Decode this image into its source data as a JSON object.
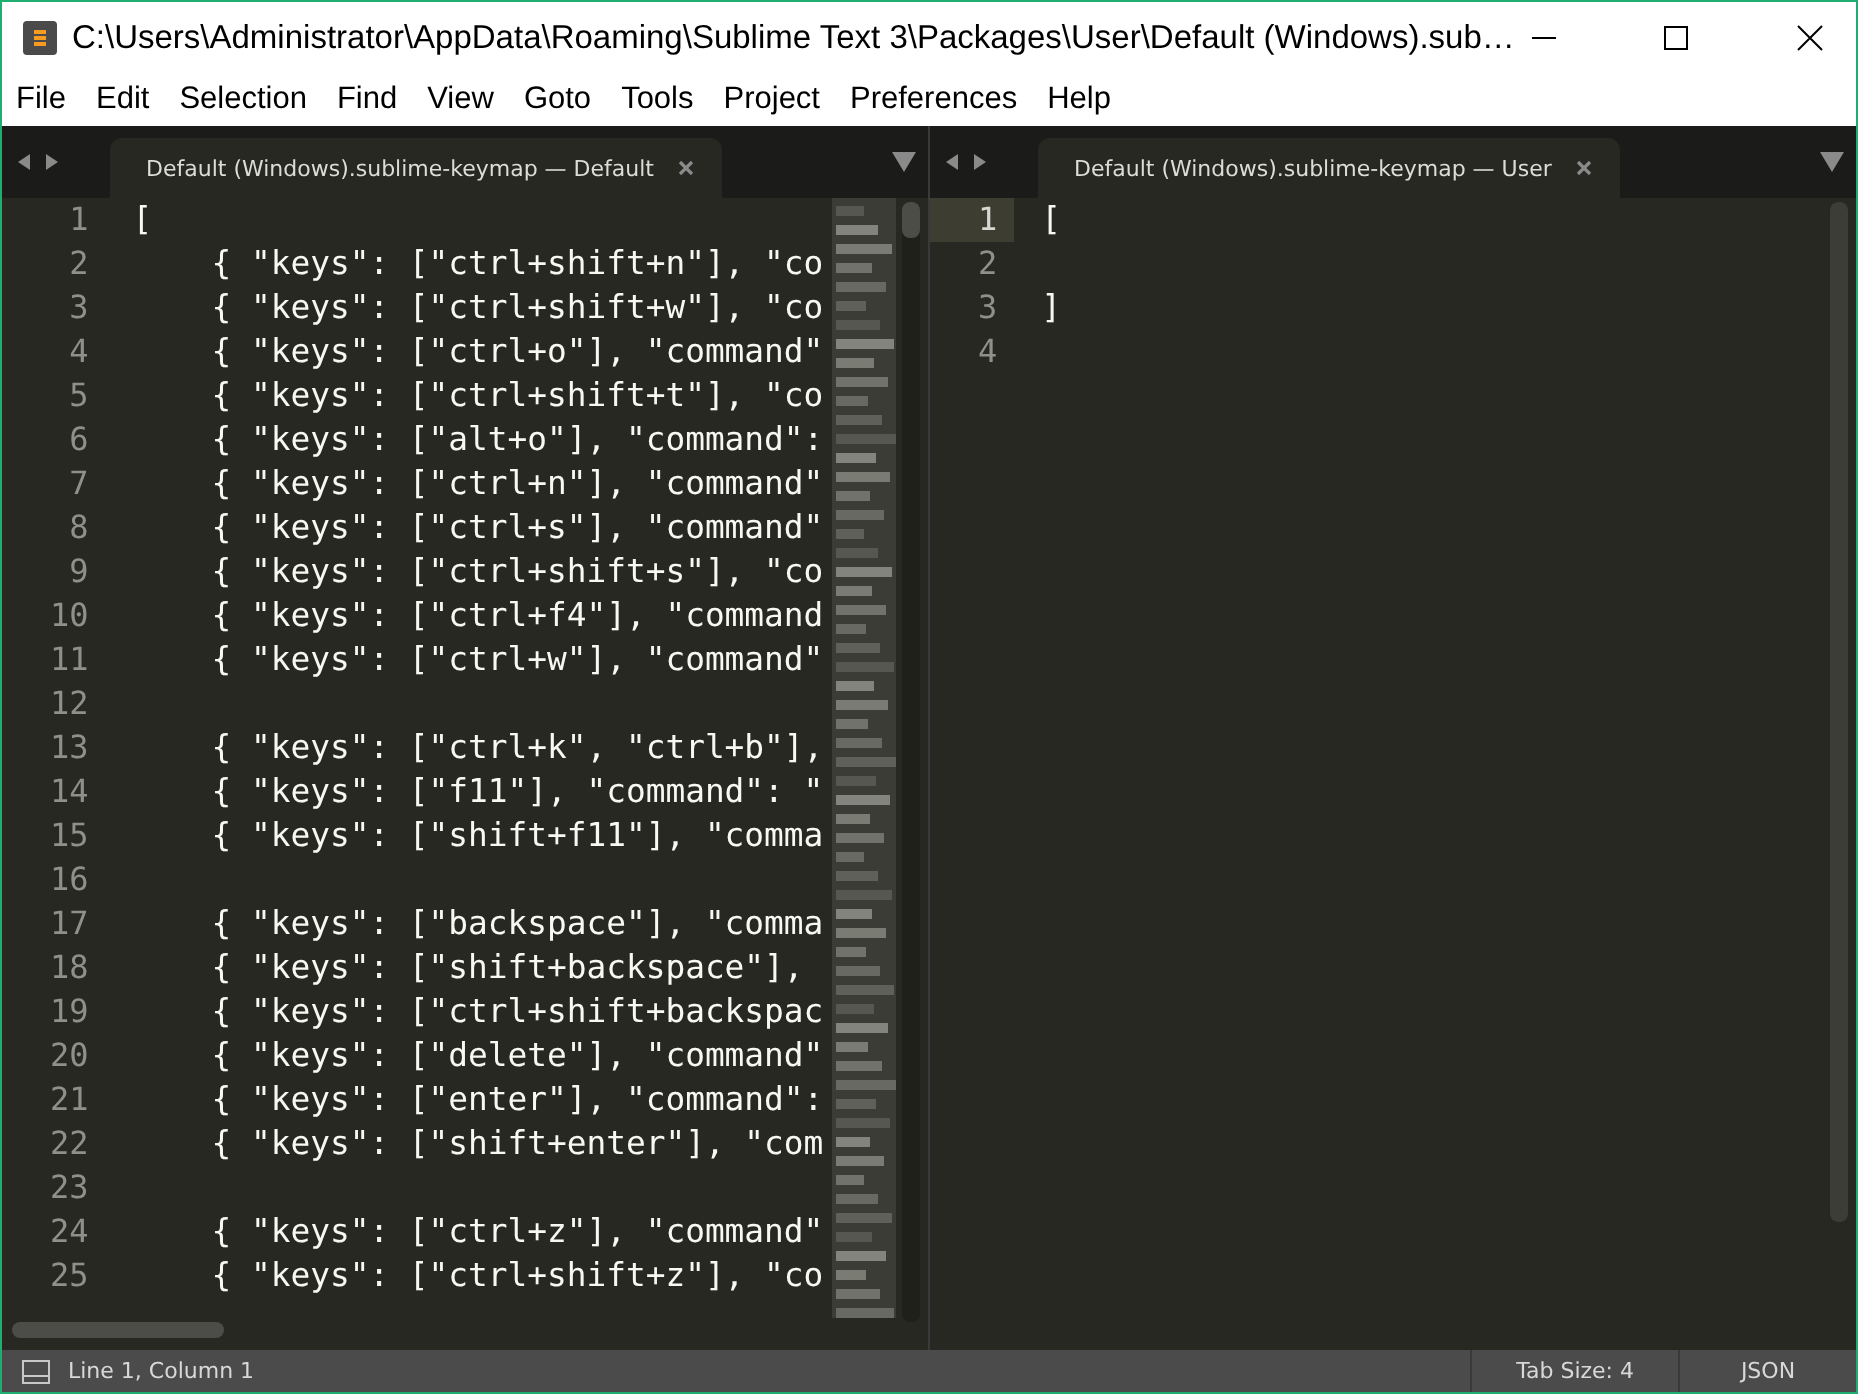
{
  "window": {
    "title": "C:\\Users\\Administrator\\AppData\\Roaming\\Sublime Text 3\\Packages\\User\\Default (Windows).sub…"
  },
  "menu": [
    "File",
    "Edit",
    "Selection",
    "Find",
    "View",
    "Goto",
    "Tools",
    "Project",
    "Preferences",
    "Help"
  ],
  "panes": [
    {
      "tab": {
        "label": "Default (Windows).sublime-keymap — Default",
        "selected": true
      },
      "minimap": true,
      "lines": [
        {
          "number": "1",
          "text": "[",
          "current": false
        },
        {
          "number": "2",
          "text": "    { \"keys\": [\"ctrl+shift+n\"], \"co",
          "current": false
        },
        {
          "number": "3",
          "text": "    { \"keys\": [\"ctrl+shift+w\"], \"co",
          "current": false
        },
        {
          "number": "4",
          "text": "    { \"keys\": [\"ctrl+o\"], \"command\"",
          "current": false
        },
        {
          "number": "5",
          "text": "    { \"keys\": [\"ctrl+shift+t\"], \"co",
          "current": false
        },
        {
          "number": "6",
          "text": "    { \"keys\": [\"alt+o\"], \"command\":",
          "current": false
        },
        {
          "number": "7",
          "text": "    { \"keys\": [\"ctrl+n\"], \"command\"",
          "current": false
        },
        {
          "number": "8",
          "text": "    { \"keys\": [\"ctrl+s\"], \"command\"",
          "current": false
        },
        {
          "number": "9",
          "text": "    { \"keys\": [\"ctrl+shift+s\"], \"co",
          "current": false
        },
        {
          "number": "10",
          "text": "    { \"keys\": [\"ctrl+f4\"], \"command",
          "current": false
        },
        {
          "number": "11",
          "text": "    { \"keys\": [\"ctrl+w\"], \"command\"",
          "current": false
        },
        {
          "number": "12",
          "current": false
        },
        {
          "number": "13",
          "text": "    { \"keys\": [\"ctrl+k\", \"ctrl+b\"],",
          "current": false
        },
        {
          "number": "14",
          "text": "    { \"keys\": [\"f11\"], \"command\": \"",
          "current": false
        },
        {
          "number": "15",
          "text": "    { \"keys\": [\"shift+f11\"], \"comma",
          "current": false
        },
        {
          "number": "16",
          "current": false
        },
        {
          "number": "17",
          "text": "    { \"keys\": [\"backspace\"], \"comma",
          "current": false
        },
        {
          "number": "18",
          "text": "    { \"keys\": [\"shift+backspace\"],",
          "current": false
        },
        {
          "number": "19",
          "text": "    { \"keys\": [\"ctrl+shift+backspac",
          "current": false
        },
        {
          "number": "20",
          "text": "    { \"keys\": [\"delete\"], \"command\"",
          "current": false
        },
        {
          "number": "21",
          "text": "    { \"keys\": [\"enter\"], \"command\":",
          "current": false
        },
        {
          "number": "22",
          "text": "    { \"keys\": [\"shift+enter\"], \"com",
          "current": false
        },
        {
          "number": "23",
          "current": false
        },
        {
          "number": "24",
          "text": "    { \"keys\": [\"ctrl+z\"], \"command\"",
          "current": false
        },
        {
          "number": "25",
          "text": "    { \"keys\": [\"ctrl+shift+z\"], \"co",
          "current": false
        }
      ]
    },
    {
      "tab": {
        "label": "Default (Windows).sublime-keymap — User",
        "selected": true
      },
      "lines": [
        {
          "number": "1",
          "text": "[",
          "current": true
        },
        {
          "number": "2",
          "current": false
        },
        {
          "number": "3",
          "text": "]",
          "current": false
        },
        {
          "number": "4",
          "current": false
        }
      ]
    }
  ],
  "status_bar": {
    "position": "Line 1, Column 1",
    "tab_size": "Tab Size: 4",
    "syntax": "JSON"
  }
}
